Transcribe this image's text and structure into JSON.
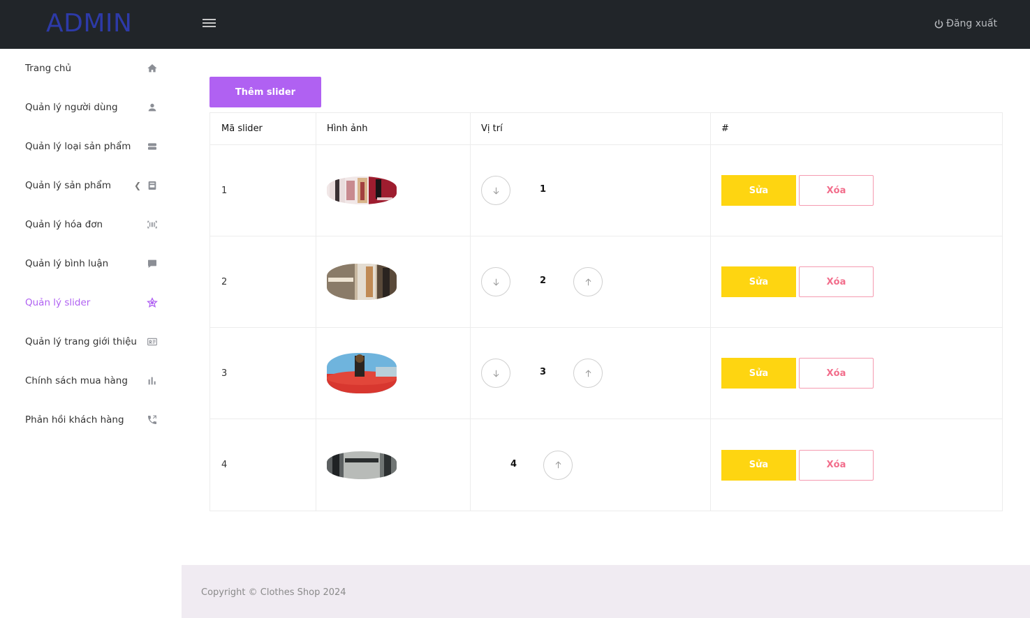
{
  "header": {
    "brand": "ADMIN",
    "logout_label": "Đăng xuất"
  },
  "sidebar": {
    "items": [
      {
        "label": "Trang chủ",
        "icon": "home-icon"
      },
      {
        "label": "Quản lý người dùng",
        "icon": "user-icon"
      },
      {
        "label": "Quản lý loại sản phẩm",
        "icon": "category-icon"
      },
      {
        "label": "Quản lý sản phẩm",
        "icon": "product-icon"
      },
      {
        "label": "Quản lý hóa đơn",
        "icon": "barcode-icon"
      },
      {
        "label": "Quản lý bình luận",
        "icon": "comment-icon"
      },
      {
        "label": "Quản lý slider",
        "icon": "star-icon",
        "active": true
      },
      {
        "label": "Quản lý trang giới thiệu",
        "icon": "id-card-icon"
      },
      {
        "label": "Chính sách mua hàng",
        "icon": "bar-chart-icon"
      },
      {
        "label": "Phản hồi khách hàng",
        "icon": "phone-icon"
      }
    ]
  },
  "main": {
    "add_button": "Thêm slider",
    "table": {
      "headers": [
        "Mã slider",
        "Hình ảnh",
        "Vị trí",
        "#"
      ],
      "rows": [
        {
          "id": "1",
          "position": "1",
          "edit": "Sửa",
          "delete": "Xóa"
        },
        {
          "id": "2",
          "position": "2",
          "edit": "Sửa",
          "delete": "Xóa"
        },
        {
          "id": "3",
          "position": "3",
          "edit": "Sửa",
          "delete": "Xóa"
        },
        {
          "id": "4",
          "position": "4",
          "edit": "Sửa",
          "delete": "Xóa"
        }
      ]
    }
  },
  "footer": {
    "copyright": "Copyright © Clothes Shop 2024"
  },
  "colors": {
    "accent": "#b061f2",
    "edit": "#fed511",
    "delete": "#f26d8b",
    "header_bg": "#212529"
  }
}
